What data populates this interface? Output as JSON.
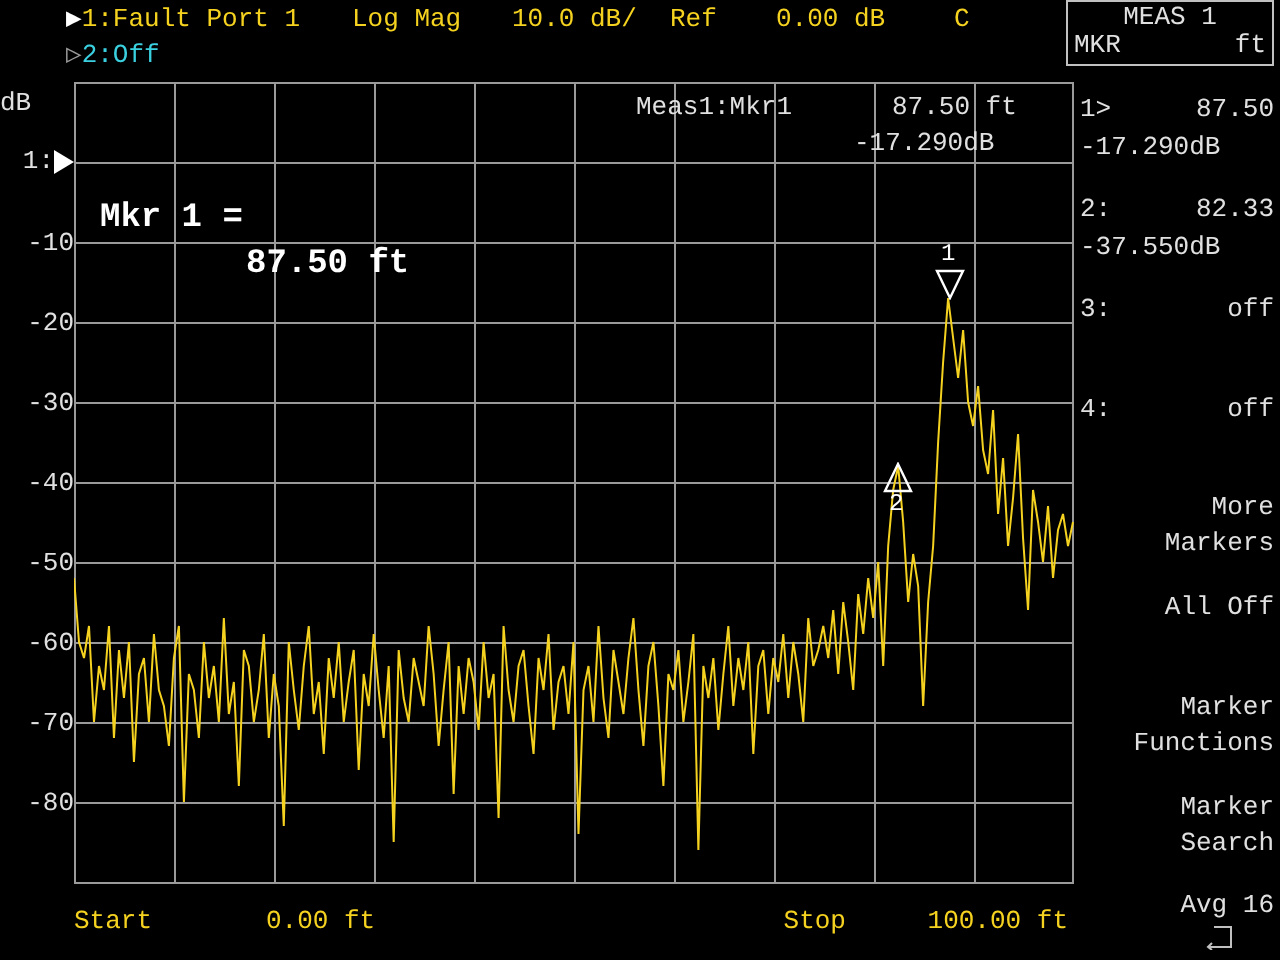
{
  "header": {
    "channel_1": {
      "indicator": "▶",
      "label": "1:Fault Port 1",
      "active": true
    },
    "format": "Log Mag",
    "scale": "10.0 dB/",
    "ref_label": "Ref",
    "ref_value": "0.00 dB",
    "cal_flag": "C"
  },
  "channel_2": {
    "indicator": "▷",
    "label": "2:Off",
    "active": false
  },
  "menu_title": {
    "title": "MEAS 1",
    "left": "MKR",
    "right": "ft"
  },
  "plot": {
    "ref_label": "1:",
    "chart_data": {
      "type": "line",
      "grid": true,
      "ylabel": "dB",
      "ylim": [
        -90,
        10
      ],
      "yticks": [
        {
          "value": -10,
          "label": "-10"
        },
        {
          "value": -20,
          "label": "-20"
        },
        {
          "value": -30,
          "label": "-30"
        },
        {
          "value": -40,
          "label": "-40"
        },
        {
          "value": -50,
          "label": "-50"
        },
        {
          "value": -60,
          "label": "-60"
        },
        {
          "value": -70,
          "label": "-70"
        },
        {
          "value": -80,
          "label": "-80"
        }
      ],
      "values": [
        -52,
        -60,
        -62,
        -58,
        -70,
        -63,
        -66,
        -58,
        -72,
        -61,
        -67,
        -60,
        -75,
        -64,
        -62,
        -70,
        -59,
        -66,
        -68,
        -73,
        -62,
        -58,
        -80,
        -64,
        -66,
        -72,
        -60,
        -67,
        -63,
        -70,
        -57,
        -69,
        -65,
        -78,
        -61,
        -63,
        -70,
        -66,
        -59,
        -72,
        -64,
        -68,
        -83,
        -60,
        -66,
        -71,
        -63,
        -58,
        -69,
        -65,
        -74,
        -62,
        -67,
        -60,
        -70,
        -65,
        -61,
        -76,
        -64,
        -68,
        -59,
        -66,
        -72,
        -63,
        -85,
        -61,
        -67,
        -70,
        -62,
        -65,
        -68,
        -58,
        -64,
        -73,
        -66,
        -60,
        -79,
        -63,
        -69,
        -62,
        -65,
        -71,
        -60,
        -67,
        -64,
        -82,
        -58,
        -66,
        -70,
        -63,
        -61,
        -68,
        -74,
        -62,
        -66,
        -59,
        -71,
        -65,
        -63,
        -69,
        -60,
        -84,
        -66,
        -63,
        -70,
        -58,
        -67,
        -72,
        -61,
        -65,
        -69,
        -62,
        -57,
        -66,
        -73,
        -63,
        -60,
        -68,
        -78,
        -64,
        -66,
        -61,
        -70,
        -65,
        -59,
        -86,
        -63,
        -67,
        -62,
        -71,
        -64,
        -58,
        -68,
        -62,
        -66,
        -60,
        -74,
        -63,
        -61,
        -69,
        -62,
        -65,
        -59,
        -67,
        -60,
        -64,
        -70,
        -57,
        -63,
        -61,
        -58,
        -62,
        -56,
        -64,
        -55,
        -60,
        -66,
        -54,
        -59,
        -52,
        -57,
        -50,
        -63,
        -48,
        -41,
        -38,
        -45,
        -55,
        -49,
        -53,
        -68,
        -55,
        -48,
        -35,
        -25,
        -17,
        -22,
        -27,
        -21,
        -30,
        -33,
        -28,
        -36,
        -39,
        -31,
        -44,
        -37,
        -48,
        -42,
        -34,
        -47,
        -56,
        -41,
        -45,
        -50,
        -43,
        -52,
        -46,
        -44,
        -48,
        -45
      ]
    },
    "readout": {
      "label": "Meas1:Mkr1",
      "x": "87.50 ft",
      "y": "-17.290dB"
    },
    "big_readout": {
      "label": "Mkr 1 =",
      "value": "87.50 ft"
    },
    "markers": [
      {
        "label": "1",
        "selected": true
      },
      {
        "label": "2",
        "selected": false
      }
    ],
    "start_label": "Start",
    "start_value": "0.00 ft",
    "stop_label": "Stop",
    "stop_value": "100.00 ft"
  },
  "softkeys": [
    {
      "kind": "marker",
      "label": "1>",
      "value": "87.50",
      "reading": "-17.290dB"
    },
    {
      "kind": "marker",
      "label": "2:",
      "value": "82.33",
      "reading": "-37.550dB"
    },
    {
      "kind": "marker",
      "label": "3:",
      "value": "off"
    },
    {
      "kind": "marker",
      "label": "4:",
      "value": "off"
    },
    {
      "kind": "button",
      "lines": [
        "More",
        "Markers"
      ]
    },
    {
      "kind": "button",
      "lines": [
        "All Off"
      ]
    },
    {
      "kind": "button",
      "lines": [
        "Marker",
        "Functions"
      ]
    },
    {
      "kind": "button",
      "lines": [
        "Marker",
        "Search"
      ]
    }
  ],
  "avg": "Avg 16"
}
